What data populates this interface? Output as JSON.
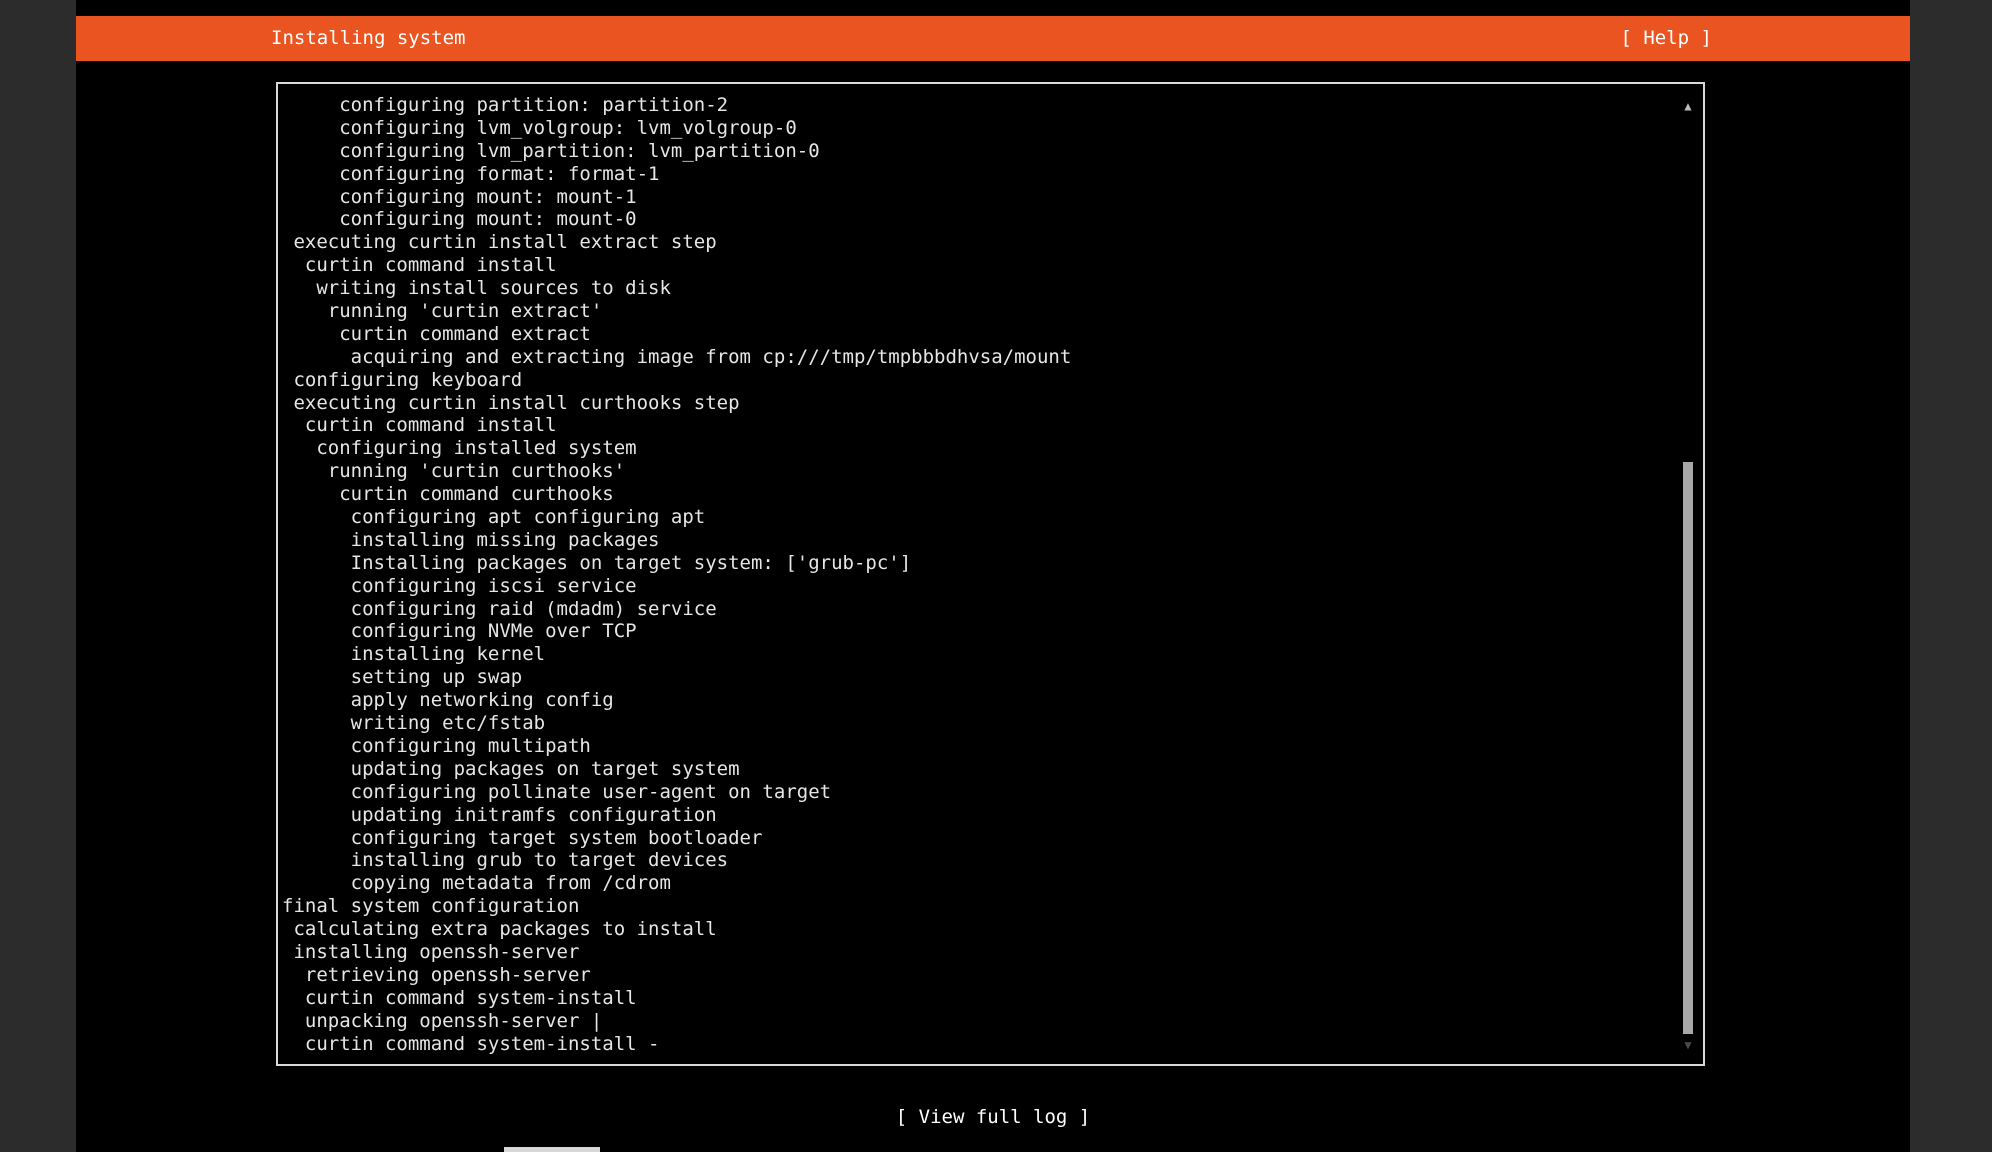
{
  "header": {
    "title": "Installing system",
    "help_label": "[ Help ]"
  },
  "log": {
    "lines": [
      "     configuring partition: partition-2",
      "     configuring lvm_volgroup: lvm_volgroup-0",
      "     configuring lvm_partition: lvm_partition-0",
      "     configuring format: format-1",
      "     configuring mount: mount-1",
      "     configuring mount: mount-0",
      " executing curtin install extract step",
      "  curtin command install",
      "   writing install sources to disk",
      "    running 'curtin extract'",
      "     curtin command extract",
      "      acquiring and extracting image from cp:///tmp/tmpbbbdhvsa/mount",
      " configuring keyboard",
      " executing curtin install curthooks step",
      "  curtin command install",
      "   configuring installed system",
      "    running 'curtin curthooks'",
      "     curtin command curthooks",
      "      configuring apt configuring apt",
      "      installing missing packages",
      "      Installing packages on target system: ['grub-pc']",
      "      configuring iscsi service",
      "      configuring raid (mdadm) service",
      "      configuring NVMe over TCP",
      "      installing kernel",
      "      setting up swap",
      "      apply networking config",
      "      writing etc/fstab",
      "      configuring multipath",
      "      updating packages on target system",
      "      configuring pollinate user-agent on target",
      "      updating initramfs configuration",
      "      configuring target system bootloader",
      "      installing grub to target devices",
      "      copying metadata from /cdrom",
      "final system configuration",
      " calculating extra packages to install",
      " installing openssh-server",
      "  retrieving openssh-server",
      "  curtin command system-install",
      "  unpacking openssh-server |",
      "  curtin command system-install -"
    ]
  },
  "footer": {
    "view_log_label": "[ View full log ]"
  },
  "colors": {
    "header_bg": "#e95420",
    "screen_bg": "#000000",
    "text": "#e6e6e6"
  }
}
